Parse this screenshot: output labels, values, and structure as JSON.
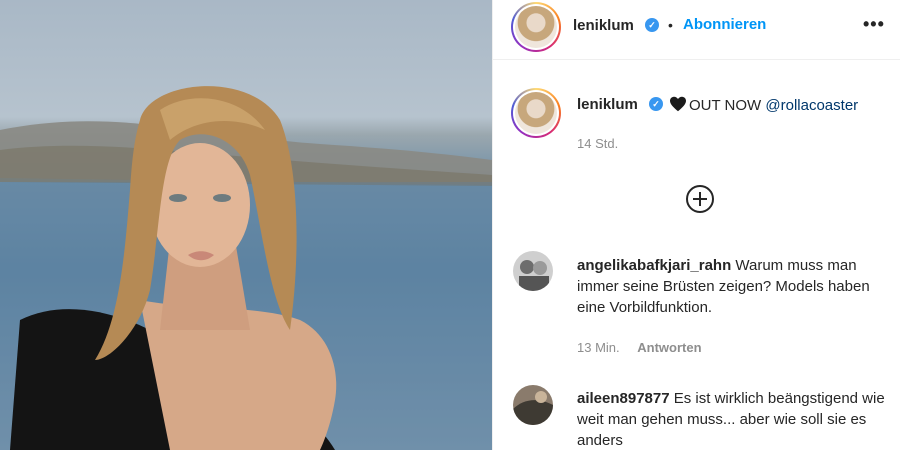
{
  "post": {
    "author": "leniklum",
    "follow_label": "Abonnieren",
    "separator": "•",
    "more_label": "•••",
    "caption_body": "OUT NOW ",
    "caption_mention": "@rollacoaster",
    "time": "14 Std."
  },
  "comments": [
    {
      "user": "angelikabafkjari_rahn",
      "text": "Warum muss man immer seine Brüsten zeigen? Models haben eine Vorbildfunktion.",
      "time": "13 Min.",
      "reply_label": "Antworten"
    },
    {
      "user": "aileen897877",
      "text": "Es ist wirklich beängstigend wie weit man gehen muss... aber wie soll sie es anders"
    }
  ],
  "colors": {
    "accent": "#0095f6",
    "verified": "#3897f0",
    "muted": "#8e8e8e"
  },
  "icons": [
    "verified-badge-icon",
    "more-options-icon",
    "black-heart-icon",
    "add-plus-icon"
  ]
}
